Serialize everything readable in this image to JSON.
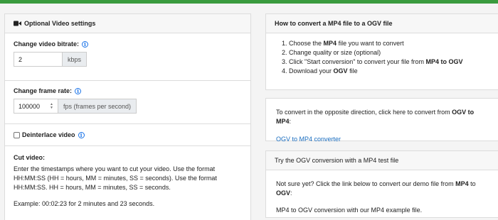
{
  "video_settings": {
    "title": "Optional Video settings",
    "bitrate": {
      "label": "Change video bitrate:",
      "value": "2",
      "unit": "kbps"
    },
    "frame_rate": {
      "label": "Change frame rate:",
      "value": "100000",
      "unit": "fps (frames per second)"
    },
    "deinterlace": {
      "label": "Deinterlace video",
      "checked": false
    },
    "cut_video": {
      "label": "Cut video:",
      "line1": "Enter the timestamps where you want to cut your video. Use the format",
      "line2": "HH:MM:SS (HH = hours, MM = minutes, SS = seconds). Use the format",
      "line3": "HH:MM:SS. HH = hours, MM = minutes, SS = seconds.",
      "example": "Example: 00:02:23 for 2 minutes and 23 seconds."
    }
  },
  "howto": {
    "title": "How to convert a MP4 file to a OGV file",
    "steps": [
      {
        "pre": "Choose the ",
        "bold": "MP4",
        "post": " file you want to convert"
      },
      {
        "pre": "Change quality or size (optional)",
        "bold": "",
        "post": ""
      },
      {
        "pre": "Click \"Start conversion\" to convert your file from ",
        "bold": "MP4 to OGV",
        "post": ""
      },
      {
        "pre": "Download your ",
        "bold": "OGV",
        "post": " file"
      }
    ]
  },
  "reverse": {
    "text_pre": "To convert in the opposite direction, click here to convert from ",
    "text_bold": "OGV to MP4",
    "text_post": ":",
    "link": "OGV to MP4 converter"
  },
  "test": {
    "title": "Try the OGV conversion with a MP4 test file",
    "text_pre": "Not sure yet? Click the link below to convert our demo file from ",
    "text_bold1": "MP4",
    "text_mid": " to ",
    "text_bold2": "OGV",
    "text_post": ":",
    "link": "MP4 to OGV conversion with our MP4 example file."
  },
  "colors": {
    "accent": "#3a9b3e",
    "link": "#1a6dbf",
    "info": "#1a73e8"
  }
}
